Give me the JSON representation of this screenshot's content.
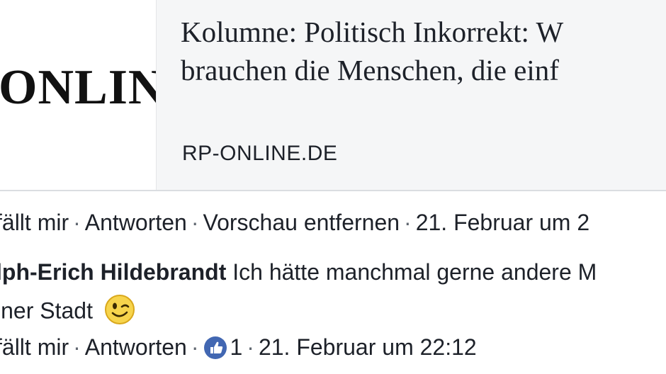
{
  "link_card": {
    "thumb_logo": "ONLIN",
    "title_line1": "Kolumne: Politisch Inkorrekt: W",
    "title_line2": "brauchen die Menschen, die einf",
    "domain": "RP-ONLINE.DE"
  },
  "post_actions": {
    "like": "fällt mir",
    "reply": "Antworten",
    "remove_preview": "Vorschau entfernen",
    "timestamp": "21. Februar um 2",
    "separator": "·"
  },
  "comment": {
    "author": "lph-Erich Hildebrandt",
    "text_line1": "Ich hätte manchmal gerne andere M",
    "text_line2": "iner Stadt",
    "emoji": "wink-emoji-icon",
    "actions": {
      "like": "fällt mir",
      "reply": "Antworten",
      "like_count": "1",
      "timestamp": "21. Februar um 22:12"
    }
  },
  "colors": {
    "text": "#1d2129",
    "card_background": "#f5f6f7",
    "divider": "#dadde1",
    "like_blue": "#4267b2",
    "emoji_yellow": "#f7d44c"
  }
}
